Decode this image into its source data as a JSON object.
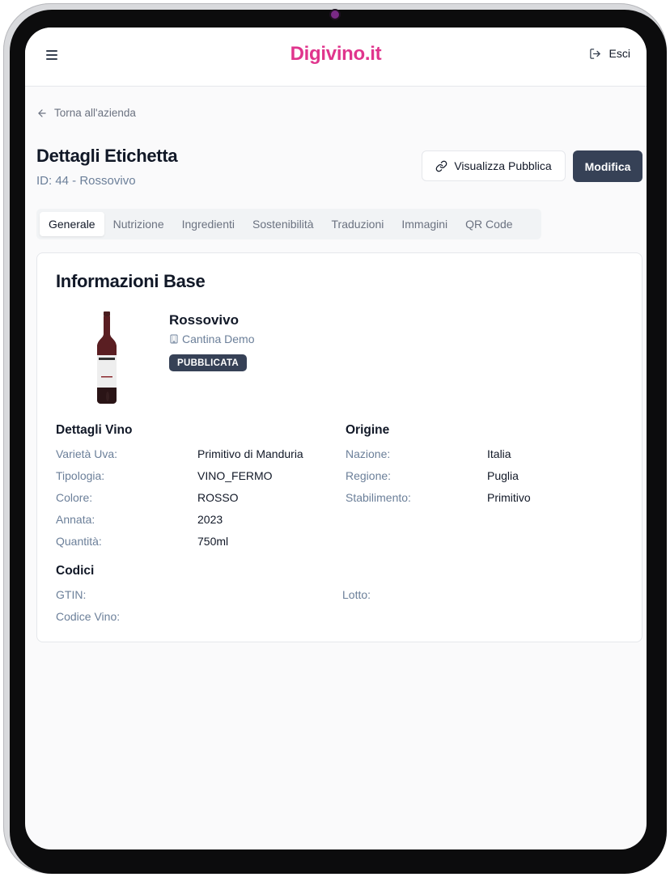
{
  "header": {
    "logo": "Digivino.it",
    "logout_label": "Esci"
  },
  "nav": {
    "back_label": "Torna all'azienda"
  },
  "page": {
    "title": "Dettagli Etichetta",
    "subtitle": "ID: 44 - Rossovivo"
  },
  "actions": {
    "public_label": "Visualizza Pubblica",
    "edit_label": "Modifica"
  },
  "tabs": [
    {
      "label": "Generale",
      "active": true
    },
    {
      "label": "Nutrizione"
    },
    {
      "label": "Ingredienti"
    },
    {
      "label": "Sostenibilità"
    },
    {
      "label": "Traduzioni"
    },
    {
      "label": "Immagini"
    },
    {
      "label": "QR Code"
    }
  ],
  "card": {
    "title": "Informazioni Base",
    "wine": {
      "name": "Rossovivo",
      "winery": "Cantina Demo",
      "status": "PUBBLICATA"
    },
    "wine_details": {
      "title": "Dettagli Vino",
      "rows": [
        {
          "label": "Varietà Uva:",
          "value": "Primitivo di Manduria"
        },
        {
          "label": "Tipologia:",
          "value": "VINO_FERMO"
        },
        {
          "label": "Colore:",
          "value": "ROSSO"
        },
        {
          "label": "Annata:",
          "value": "2023"
        },
        {
          "label": "Quantità:",
          "value": "750ml"
        }
      ]
    },
    "origin": {
      "title": "Origine",
      "rows": [
        {
          "label": "Nazione:",
          "value": "Italia"
        },
        {
          "label": "Regione:",
          "value": "Puglia"
        },
        {
          "label": "Stabilimento:",
          "value": "Primitivo"
        }
      ]
    },
    "codes": {
      "title": "Codici",
      "gtin_label": "GTIN:",
      "lotto_label": "Lotto:",
      "codice_label": "Codice Vino:"
    }
  },
  "colors": {
    "brand": "#e0358d",
    "primary_button": "#364156",
    "muted_label": "#6b7f99"
  },
  "icons": {
    "menu": "hamburger-menu-icon",
    "logout": "logout-icon",
    "back": "arrow-left-icon",
    "public_link": "link-icon",
    "winery": "building-icon"
  }
}
